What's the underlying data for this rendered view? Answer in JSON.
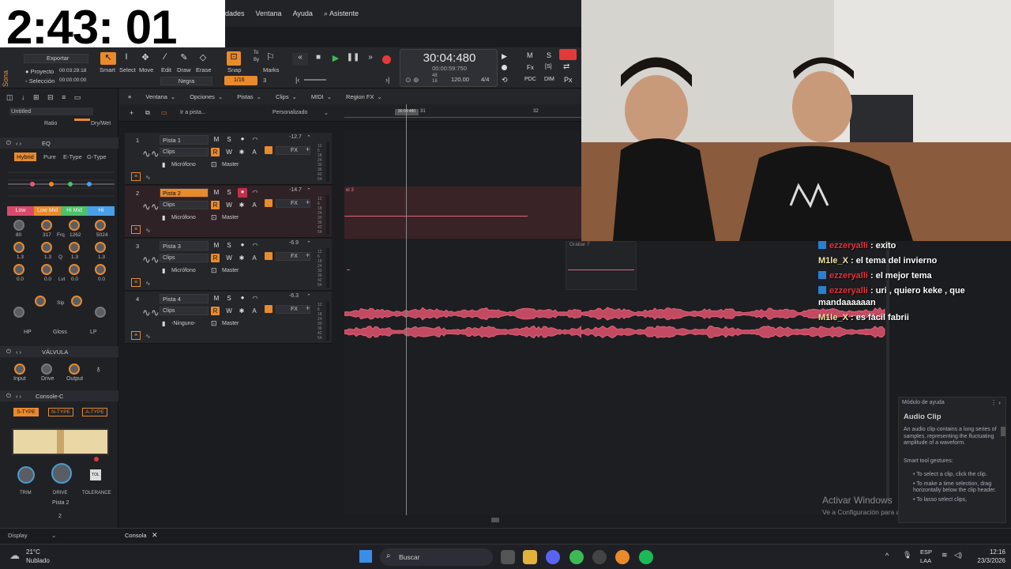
{
  "overlay": {
    "clock": "2:43: 01"
  },
  "menu": {
    "items": [
      "dades",
      "Ventana",
      "Ayuda",
      "Asistente"
    ]
  },
  "toolbar": {
    "app_name": "Sona",
    "export_label": "Exportar",
    "project_label": "Proyecto",
    "project_time": "00:03:29:18",
    "selection_label": "Selección",
    "selection_time": "00:00:00:00",
    "tools": [
      "Smart",
      "Select",
      "Move",
      "Edit",
      "Draw",
      "Erase"
    ],
    "font_style": "Negra",
    "snap_label": "Snap",
    "snap_value": "1/16",
    "marks_label": "Marks",
    "marks_value": "3",
    "to_by": [
      "To",
      "By"
    ]
  },
  "transport": {
    "time": "30:04:480",
    "subtime": "00:00:59:750",
    "bpm": "120.00",
    "sig": "4/4",
    "sub1": "48",
    "sub2": "16",
    "right_buttons": [
      "M",
      "S",
      "Fx",
      "[S]",
      "PDC",
      "DIM",
      "Px"
    ]
  },
  "track_menu": [
    "Ventana",
    "Opciones",
    "Pistas",
    "Clips",
    "MIDI",
    "Region FX"
  ],
  "track_toolbar": {
    "goto": "Ir a pista...",
    "custom": "Personalizado",
    "ruler": [
      "30:04:480",
      "31",
      "32"
    ]
  },
  "inspector": {
    "project": "Untitled",
    "ratio": "Ratio",
    "drywet": "Dry/Wet",
    "eq": {
      "title": "EQ",
      "modes": [
        "Hybrid",
        "Pure",
        "E-Type",
        "G-Type"
      ],
      "bands": [
        "Low",
        "Low Mid",
        "Hi Mid",
        "Hi"
      ],
      "values": [
        "80",
        "317",
        "Frq",
        "1262",
        "5024"
      ],
      "q": [
        "1.3",
        "1.3",
        "Q",
        "1.3",
        "1.3"
      ],
      "lvl": [
        "0.0",
        "0.0",
        "Lvl",
        "0.0",
        "0.0"
      ],
      "slp": "Slp",
      "filters": [
        "HP",
        "Gloss",
        "LP"
      ]
    },
    "valve": {
      "title": "VÁLVULA",
      "knobs": [
        "Input",
        "Drive",
        "Output"
      ]
    },
    "console": {
      "title": "Console-C",
      "types": [
        "S-TYPE",
        "N-TYPE",
        "A-TYPE"
      ],
      "knobs": [
        "TRIM",
        "DRIVE",
        "TOLERANCE"
      ],
      "tol": "TOL",
      "track": "Pista 2",
      "num": "2"
    }
  },
  "tracks": [
    {
      "num": "1",
      "name": "Pista 1",
      "clips": "Clips",
      "input": "Micrófono",
      "output": "Master",
      "gain": "-12.7",
      "selected": false
    },
    {
      "num": "2",
      "name": "Pista 2",
      "clips": "Clips",
      "input": "Micrófono",
      "output": "Master",
      "gain": "-14.7",
      "selected": true
    },
    {
      "num": "3",
      "name": "Pista 3",
      "clips": "Clips",
      "input": "Micrófono",
      "output": "Master",
      "gain": "-6.9",
      "selected": false
    },
    {
      "num": "4",
      "name": "Pista 4",
      "clips": "Clips",
      "input": "-Ninguno-",
      "output": "Master",
      "gain": "-6.3",
      "selected": false
    }
  ],
  "buttons": {
    "m": "M",
    "s": "S",
    "r": "R",
    "w": "W",
    "a": "A",
    "fx": "FX"
  },
  "clip_labels": {
    "p2": "el 3",
    "p3": "Grabar 7"
  },
  "chat": [
    {
      "user": "ezzeryalli",
      "color": "red",
      "msg": "exito"
    },
    {
      "user": "M1le_X",
      "color": "yellow",
      "msg": "el tema del invierno"
    },
    {
      "user": "ezzeryalli",
      "color": "red",
      "msg": "el mejor tema"
    },
    {
      "user": "ezzeryalli",
      "color": "red",
      "msg": "uri , quiero keke , que mandaaaaaan"
    },
    {
      "user": "M1le_X",
      "color": "yellow",
      "msg": "es fácil fabrii"
    }
  ],
  "help": {
    "title": "Módulo de ayuda",
    "heading": "Audio Clip",
    "body": "An audio clip contains a long series of samples, representing the fluctuating amplitude of a waveform.",
    "subhead": "Smart tool gestures:",
    "bullets": [
      "To select a clip, click the clip.",
      "To make a time selection, drag horizontally below the clip header.",
      "To lasso select clips,"
    ]
  },
  "watermark": {
    "line1": "Activar Windows",
    "line2": "Ve a Configuración para activar Windows."
  },
  "statusbar": {
    "display": "Display",
    "console": "Consola"
  },
  "taskbar": {
    "temp": "21°C",
    "weather": "Nublado",
    "search": "Buscar",
    "lang1": "ESP",
    "lang2": "LAA",
    "time": "12:16",
    "date": "23/3/2026"
  }
}
